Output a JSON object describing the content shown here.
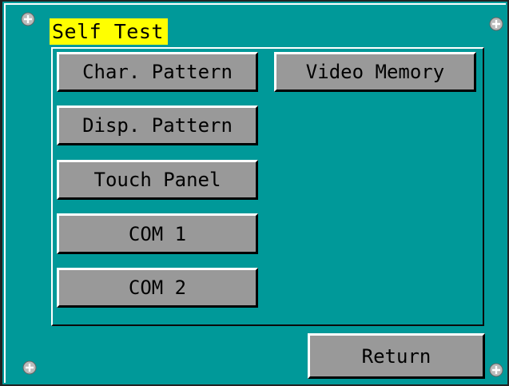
{
  "window": {
    "title": "Self Test"
  },
  "buttons": {
    "char_pattern": "Char. Pattern",
    "video_memory": "Video Memory",
    "disp_pattern": "Disp. Pattern",
    "touch_panel": "Touch Panel",
    "com1": "COM 1",
    "com2": "COM 2",
    "return": "Return"
  },
  "screws": [
    "screw-icon",
    "screw-icon",
    "screw-icon",
    "screw-icon"
  ],
  "colors": {
    "background": "#009999",
    "title_highlight": "#ffff00",
    "button_face": "#999999",
    "bevel_light": "#ffffff",
    "bevel_dark": "#000000"
  }
}
